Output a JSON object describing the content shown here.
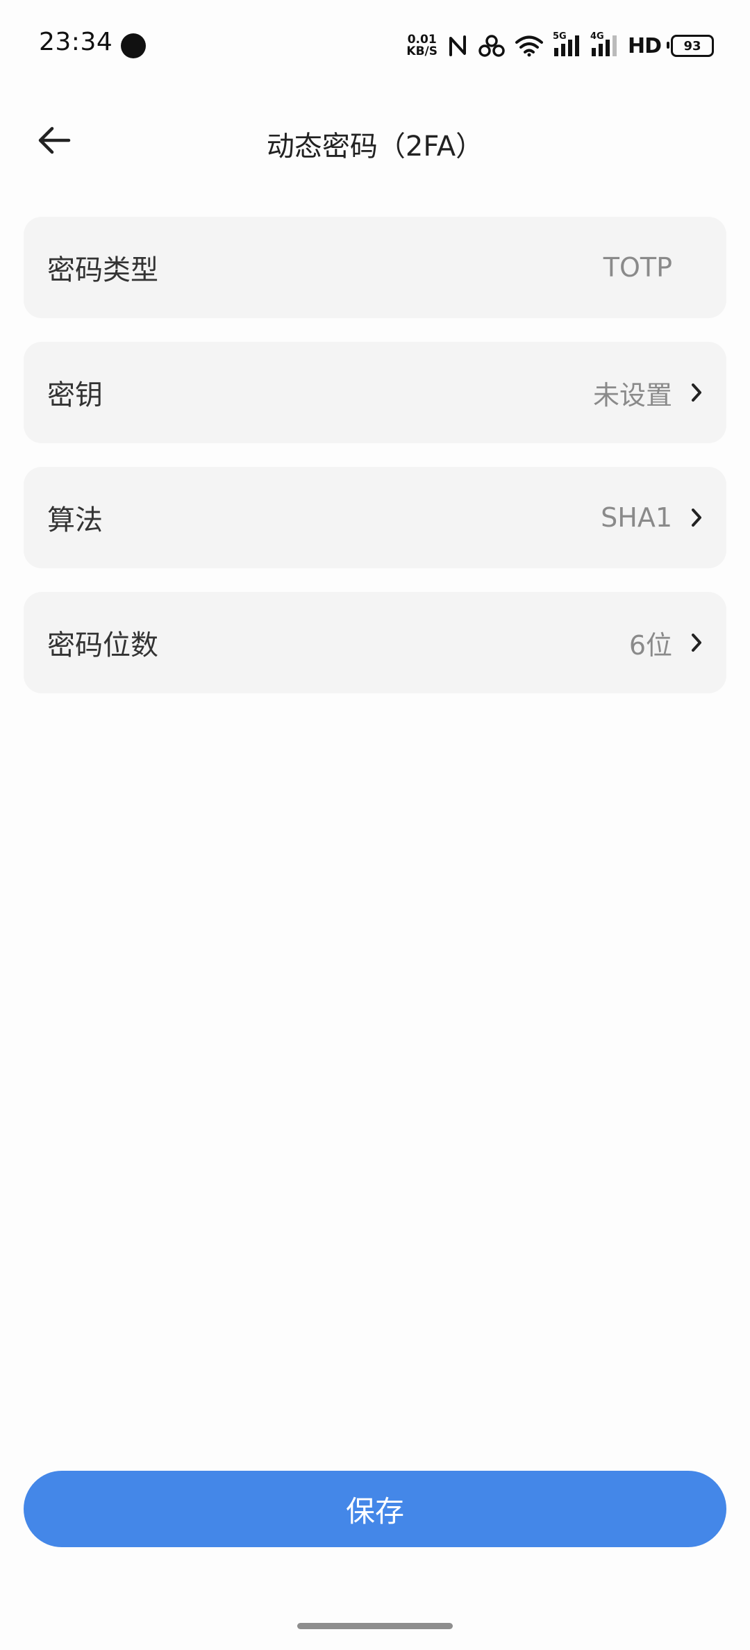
{
  "status_bar": {
    "time": "23:34",
    "net_speed_value": "0.01",
    "net_speed_unit": "KB/S",
    "signal_1_label": "5G",
    "signal_2_label": "4G",
    "hd_label": "HD",
    "battery_level": "93",
    "icons": [
      "notification-dot-icon",
      "nfc-icon",
      "hotspot-icon",
      "wifi-icon",
      "signal-5g-icon",
      "signal-4g-icon",
      "battery-icon"
    ]
  },
  "header": {
    "title": "动态密码（2FA）",
    "back_icon": "arrow-left-icon"
  },
  "settings": [
    {
      "label": "密码类型",
      "value": "TOTP",
      "has_chevron": false
    },
    {
      "label": "密钥",
      "value": "未设置",
      "has_chevron": true
    },
    {
      "label": "算法",
      "value": "SHA1",
      "has_chevron": true
    },
    {
      "label": "密码位数",
      "value": "6位",
      "has_chevron": true
    }
  ],
  "actions": {
    "save_label": "保存"
  },
  "colors": {
    "accent": "#4487e8",
    "card_bg": "#f4f4f4",
    "value_text": "#8a8a8a"
  }
}
